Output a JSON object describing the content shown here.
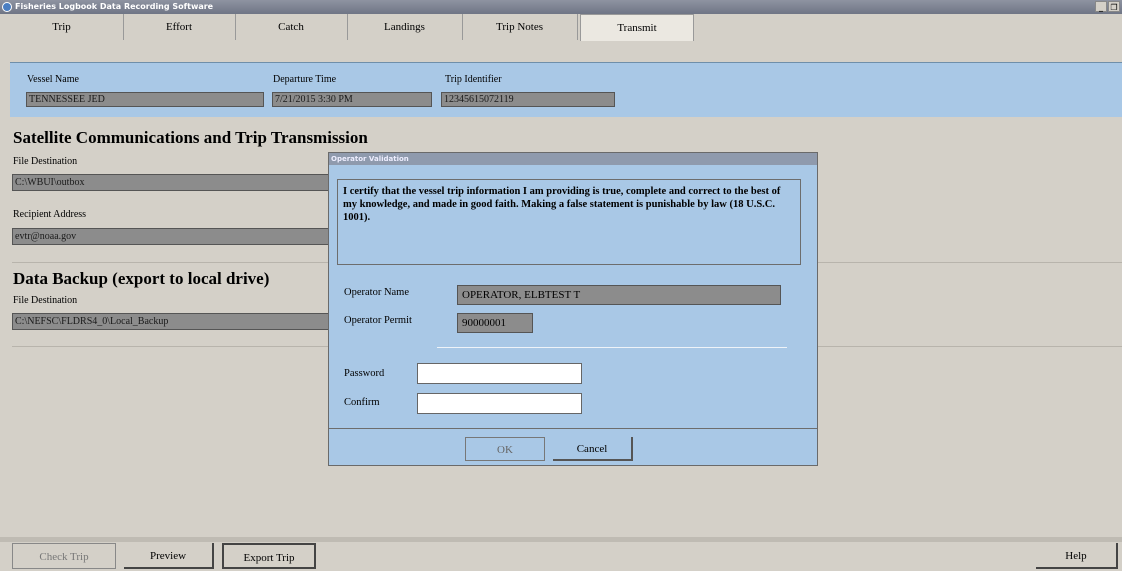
{
  "window": {
    "title": "Fisheries Logbook Data Recording Software",
    "icon": "globe-icon"
  },
  "tabs": [
    {
      "label": "Trip"
    },
    {
      "label": "Effort"
    },
    {
      "label": "Catch"
    },
    {
      "label": "Landings"
    },
    {
      "label": "Trip Notes"
    },
    {
      "label": "Transmit",
      "active": true
    }
  ],
  "vessel": {
    "name_label": "Vessel Name",
    "name_value": "TENNESSEE JED",
    "departure_label": "Departure Time",
    "departure_value": "7/21/2015 3:30 PM",
    "trip_id_label": "Trip Identifier",
    "trip_id_value": "12345615072119"
  },
  "satellite": {
    "title": "Satellite Communications and Trip Transmission",
    "file_dest_label": "File Destination",
    "file_dest_value": "C:\\WBUI\\outbox",
    "recipient_label": "Recipient Address",
    "recipient_value": "evtr@noaa.gov"
  },
  "backup": {
    "title": "Data Backup (export to local drive)",
    "file_dest_label": "File Destination",
    "file_dest_value": "C:\\NEFSC\\FLDRS4_0\\Local_Backup"
  },
  "dialog": {
    "title": "Operator Validation",
    "certification": "I certify that the vessel trip information I am providing is true, complete and correct to the best of my knowledge, and made in good faith.  Making a false statement is punishable by law (18 U.S.C. 1001).",
    "operator_name_label": "Operator Name",
    "operator_name_value": "OPERATOR, ELBTEST T",
    "operator_permit_label": "Operator Permit",
    "operator_permit_value": "90000001",
    "password_label": "Password",
    "password_value": "",
    "confirm_label": "Confirm",
    "confirm_value": "",
    "ok_label": "OK",
    "cancel_label": "Cancel"
  },
  "bottom": {
    "check_trip": "Check Trip",
    "preview": "Preview",
    "export_trip": "Export Trip",
    "help": "Help"
  },
  "colors": {
    "panel_blue": "#a9c8e6",
    "window_gray": "#d4d0c8",
    "field_gray": "#8c8c8c"
  }
}
